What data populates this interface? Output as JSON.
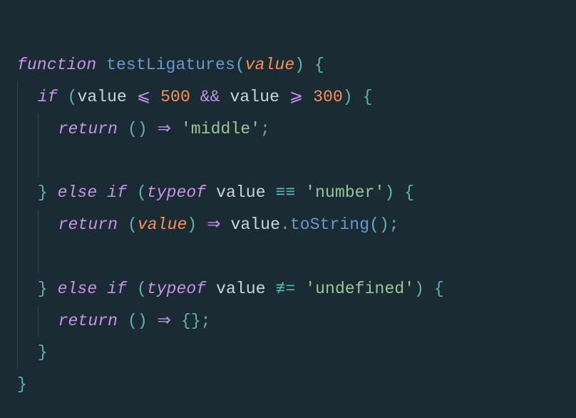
{
  "kw_function": "function",
  "fn_name": "testLigatures",
  "param": "value",
  "kw_if": "if",
  "kw_else_if": "else if",
  "kw_typeof": "typeof",
  "kw_return": "return",
  "op_le": "⩽",
  "op_ge": "⩾",
  "op_and": "&&",
  "op_eq3": "≡≡",
  "op_neq3": "≢=",
  "op_arrow": "⇒",
  "num_500": "500",
  "num_300": "300",
  "str_middle": "'middle'",
  "str_number": "'number'",
  "str_undefined": "'undefined'",
  "call_toString": "toString",
  "p_open": "(",
  "p_close": ")",
  "b_open": "{",
  "b_close": "}",
  "semi": ";",
  "dot": "."
}
